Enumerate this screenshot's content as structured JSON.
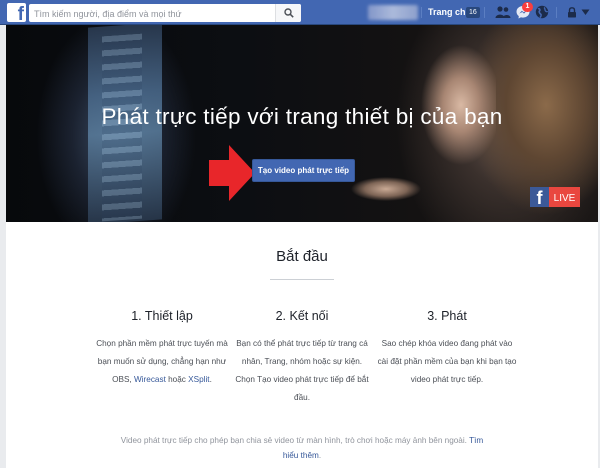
{
  "topbar": {
    "logo": "f",
    "search_placeholder": "Tìm kiếm người, địa điểm và mọi thứ",
    "home_label": "Trang chủ",
    "home_count": "16",
    "notification_count": "1",
    "icons": [
      "search-icon",
      "friend-requests-icon",
      "messages-icon",
      "globe-icon",
      "lock-icon",
      "dropdown-icon"
    ]
  },
  "hero": {
    "title": "Phát trực tiếp với trang thiết bị của bạn",
    "cta_label": "Tạo video phát trực tiếp",
    "live_logo": "f",
    "live_label": "LIVE",
    "colors": {
      "cta": "#4267b2",
      "arrow": "#e8262a",
      "live": "#e9473f"
    }
  },
  "content": {
    "title": "Bắt đầu",
    "steps": [
      {
        "title": "1. Thiết lập",
        "text_a": "Chọn phần mềm phát trực tuyến mà bạn muốn sử dụng, chẳng hạn như OBS,",
        "link_a": "Wirecast",
        "text_b": "hoặc",
        "link_b": "XSplit",
        "text_c": "."
      },
      {
        "title": "2. Kết nối",
        "text": "Bạn có thể phát trực tiếp từ trang cá nhân, Trang, nhóm hoặc sự kiện. Chọn Tạo video phát trực tiếp để bắt đầu."
      },
      {
        "title": "3. Phát",
        "text": "Sao chép khóa video đang phát vào cài đặt phần mềm của bạn khi bạn tạo video phát trực tiếp."
      }
    ],
    "footer_text": "Video phát trực tiếp cho phép bạn chia sẻ video từ màn hình, trò chơi hoặc máy ảnh bên ngoài.",
    "footer_link": "Tìm hiểu thêm",
    "footer_end": "."
  }
}
